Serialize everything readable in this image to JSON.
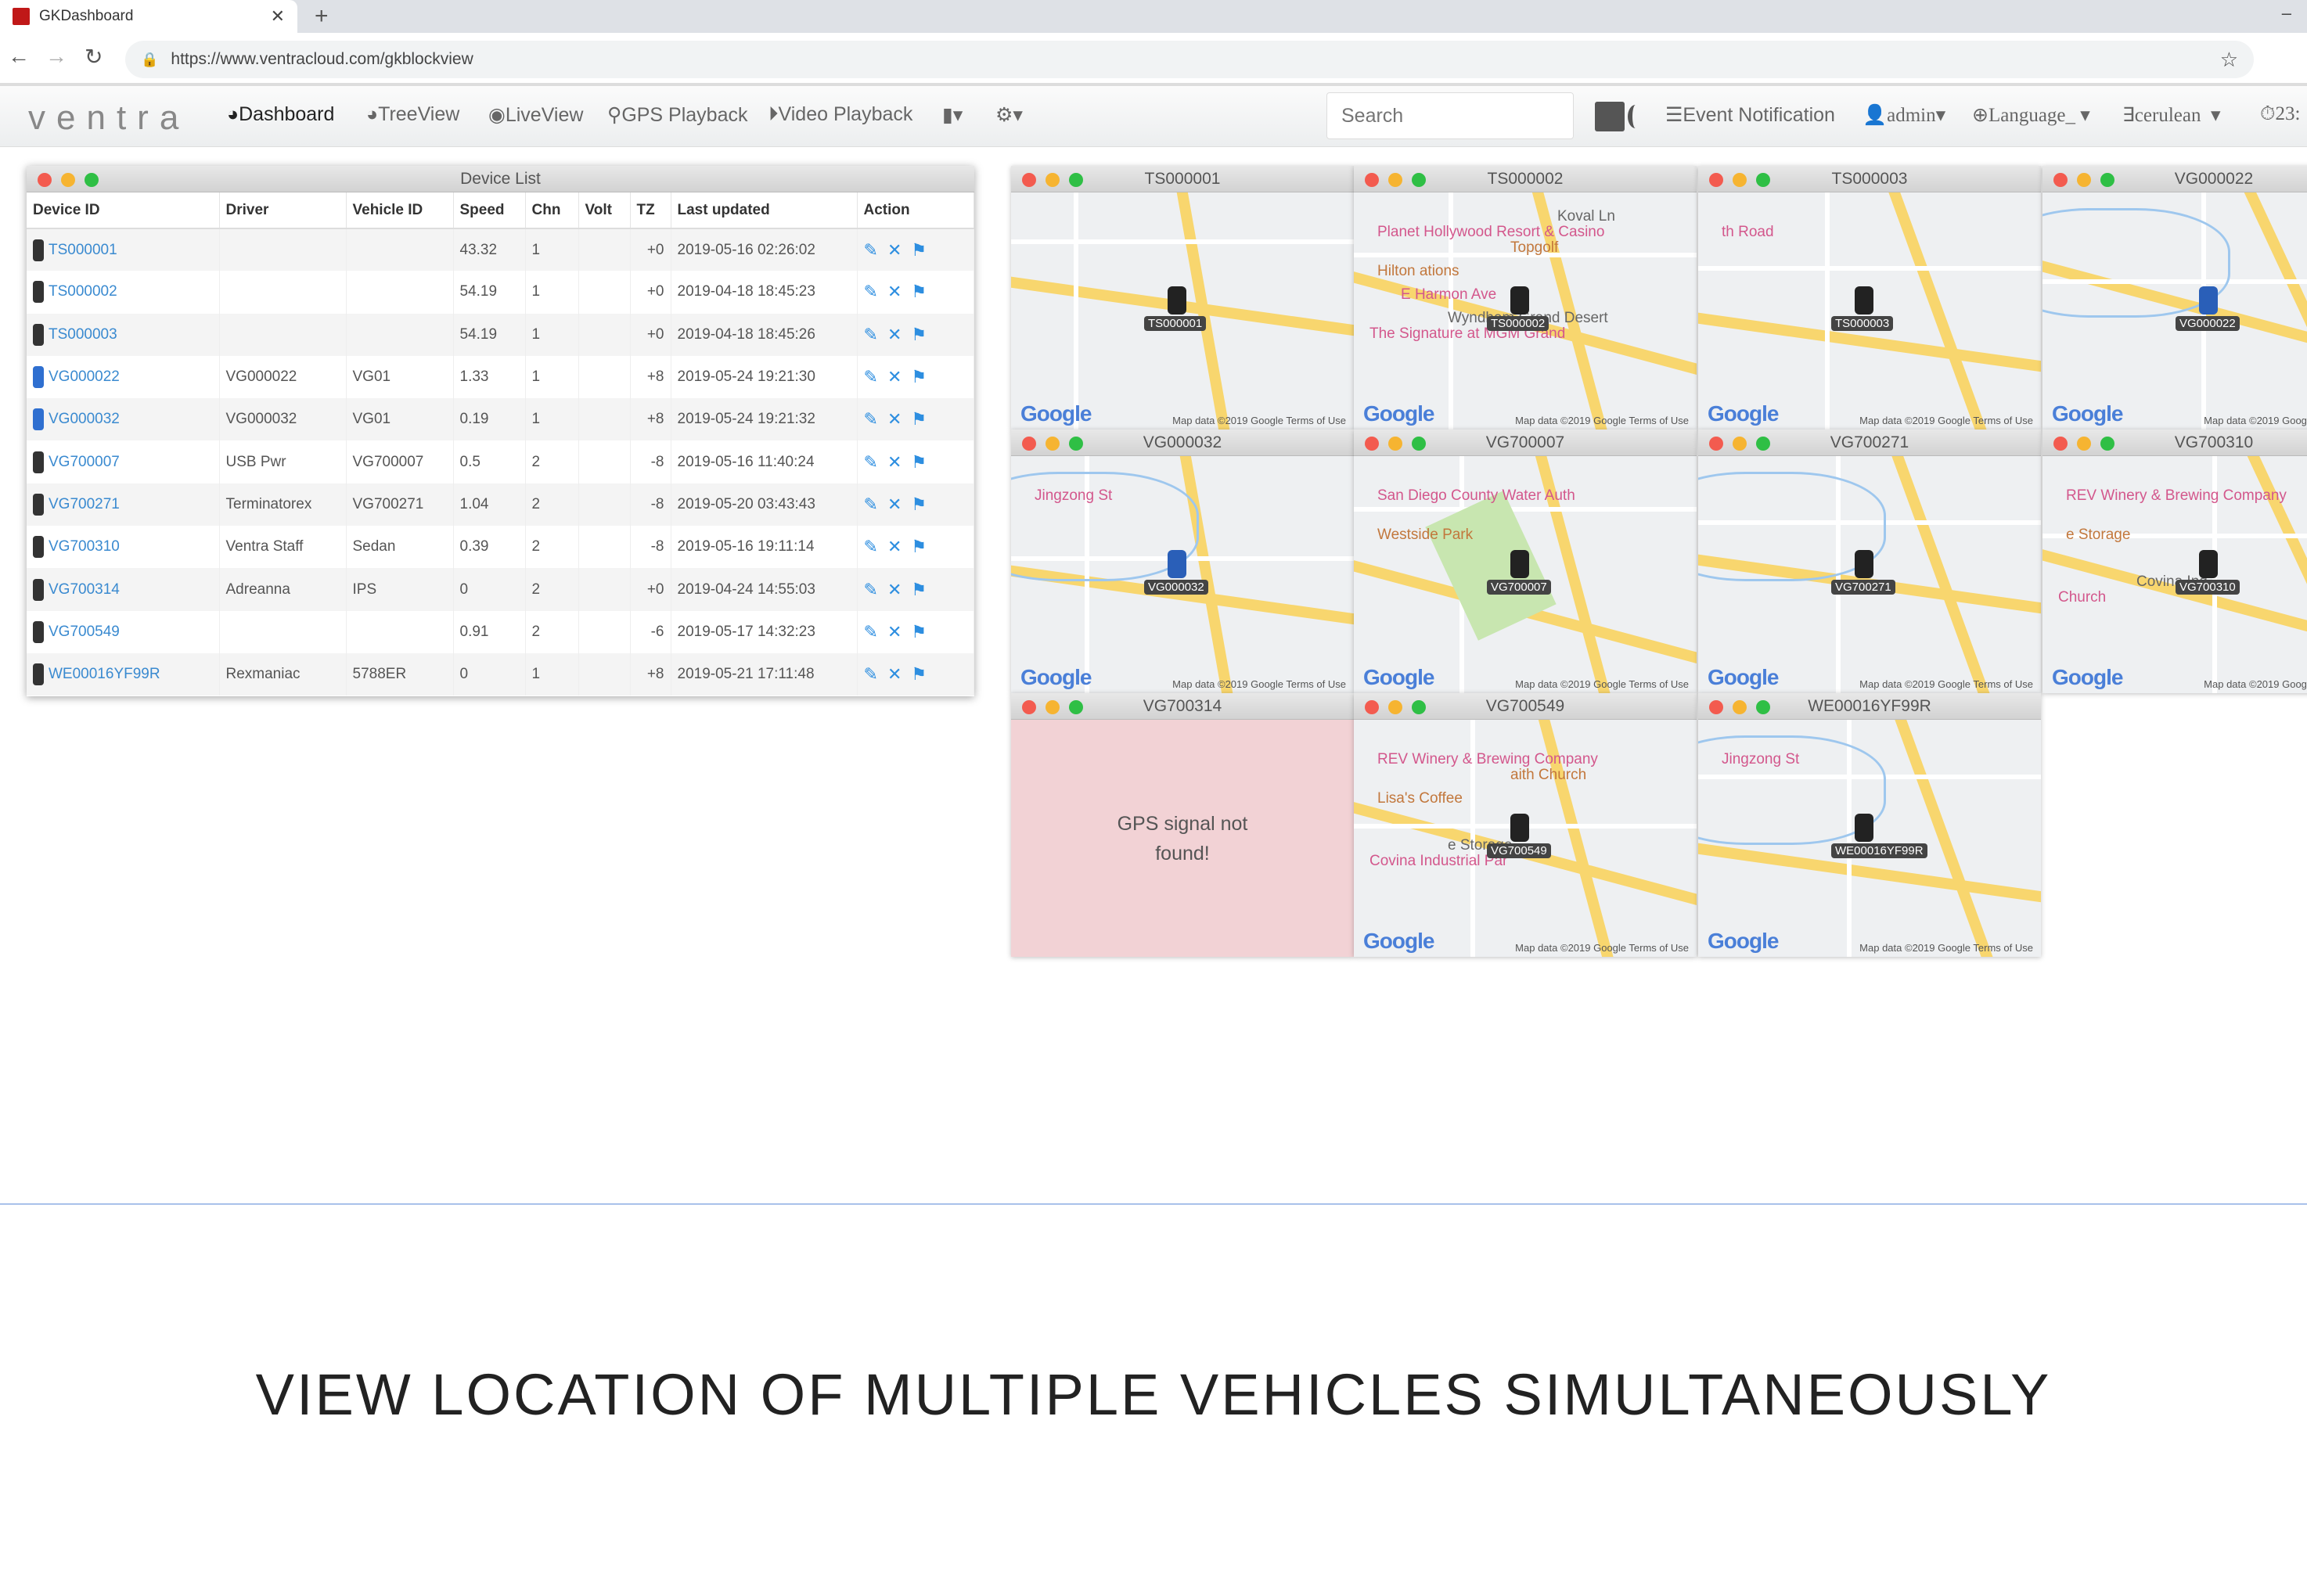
{
  "browser": {
    "tab_title": "GKDashboard",
    "url": "https://www.ventracloud.com/gkblockview"
  },
  "app": {
    "logo": "ventra",
    "nav": [
      "Dashboard",
      "TreeView",
      "LiveView",
      "GPS Playback",
      "Video Playback"
    ],
    "search_placeholder": "Search",
    "event_notification": "Event Notification",
    "user": "admin",
    "language": "Language_",
    "theme": "cerulean",
    "clock": "23:"
  },
  "device_list": {
    "title": "Device List",
    "columns": [
      "Device ID",
      "Driver",
      "Vehicle ID",
      "Speed",
      "Chn",
      "Volt",
      "TZ",
      "Last updated",
      "Action"
    ],
    "rows": [
      [
        "TS000001",
        "",
        "",
        "43.32",
        "1",
        "",
        "+0",
        "2019-05-16 02:26:02"
      ],
      [
        "TS000002",
        "",
        "",
        "54.19",
        "1",
        "",
        "+0",
        "2019-04-18 18:45:23"
      ],
      [
        "TS000003",
        "",
        "",
        "54.19",
        "1",
        "",
        "+0",
        "2019-04-18 18:45:26"
      ],
      [
        "VG000022",
        "VG000022",
        "VG01",
        "1.33",
        "1",
        "",
        "+8",
        "2019-05-24 19:21:30"
      ],
      [
        "VG000032",
        "VG000032",
        "VG01",
        "0.19",
        "1",
        "",
        "+8",
        "2019-05-24 19:21:32"
      ],
      [
        "VG700007",
        "USB Pwr",
        "VG700007",
        "0.5",
        "2",
        "",
        "-8",
        "2019-05-16 11:40:24"
      ],
      [
        "VG700271",
        "Terminatorex",
        "VG700271",
        "1.04",
        "2",
        "",
        "-8",
        "2019-05-20 03:43:43"
      ],
      [
        "VG700310",
        "Ventra Staff",
        "Sedan",
        "0.39",
        "2",
        "",
        "-8",
        "2019-05-16 19:11:14"
      ],
      [
        "VG700314",
        "Adreanna",
        "IPS",
        "0",
        "2",
        "",
        "+0",
        "2019-04-24 14:55:03"
      ],
      [
        "VG700549",
        "",
        "",
        "0.91",
        "2",
        "",
        "-6",
        "2019-05-17 14:32:23"
      ],
      [
        "WE00016YF99R",
        "Rexmaniac",
        "5788ER",
        "0",
        "1",
        "",
        "+8",
        "2019-05-21 17:11:48"
      ]
    ]
  },
  "map_tiles": [
    {
      "id": "TS000001",
      "pois": []
    },
    {
      "id": "TS000002",
      "pois": [
        "Planet Hollywood Resort & Casino",
        "Hilton ations",
        "Wyndham Grand Desert",
        "The Signature at MGM Grand",
        "Topgolf",
        "Koval Ln",
        "E Harmon Ave"
      ]
    },
    {
      "id": "TS000003",
      "pois": [
        "th Road"
      ]
    },
    {
      "id": "VG000022",
      "pois": []
    },
    {
      "id": "VG000032",
      "pois": [
        "Jingzong St"
      ]
    },
    {
      "id": "VG700007",
      "pois": [
        "San Diego County Water Auth",
        "Westside Park"
      ]
    },
    {
      "id": "VG700271",
      "pois": []
    },
    {
      "id": "VG700310",
      "pois": [
        "REV Winery & Brewing Company",
        "e Storage",
        "Covina Ind",
        "Church"
      ]
    },
    {
      "id": "VG700314",
      "no_signal": "GPS signal not found!"
    },
    {
      "id": "VG700549",
      "pois": [
        "REV Winery & Brewing Company",
        "Lisa's Coffee",
        "e Storage",
        "Covina Industrial Par",
        "aith Church"
      ]
    },
    {
      "id": "WE00016YF99R",
      "pois": [
        "Jingzong St"
      ]
    }
  ],
  "map_common": {
    "google": "Google",
    "mapdata": "Map data ©2019 Google",
    "terms": "Terms of Use"
  },
  "caption": "VIEW LOCATION OF MULTIPLE VEHICLES SIMULTANEOUSLY"
}
